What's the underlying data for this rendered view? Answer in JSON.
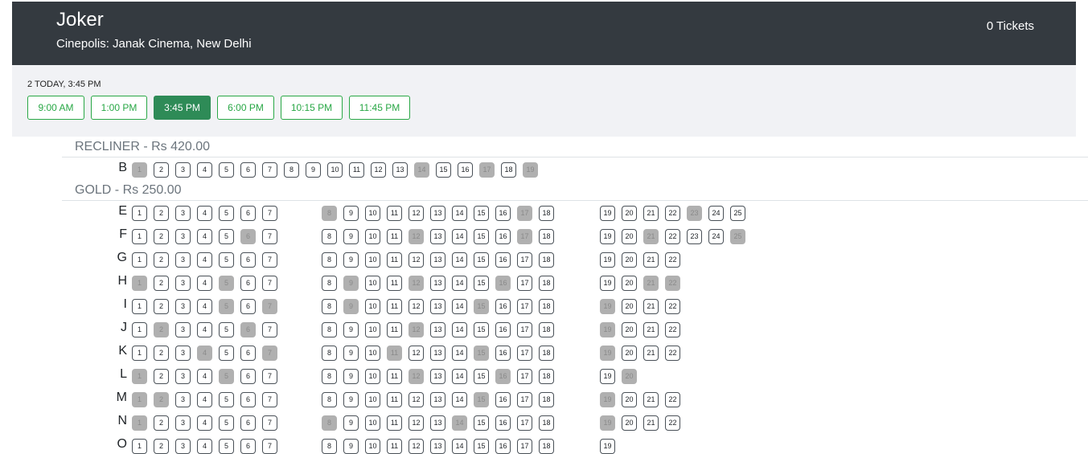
{
  "header": {
    "movie_title": "Joker",
    "venue": "Cinepolis: Janak Cinema, New Delhi",
    "tickets": "0 Tickets"
  },
  "showtimes": {
    "date_label": "2 TODAY, 3:45 PM",
    "times": [
      "9:00 AM",
      "1:00 PM",
      "3:45 PM",
      "6:00 PM",
      "10:15 PM",
      "11:45 PM"
    ],
    "selected": "3:45 PM"
  },
  "colors": {
    "header_bg": "#343a40",
    "accent": "#28a745",
    "selected": "#2e8b57",
    "sold_seat": "#b0b0b0"
  },
  "categories": [
    {
      "name": "RECLINER - Rs 420.00",
      "rows": [
        {
          "label": "B",
          "blocks": [
            [
              1,
              2,
              3,
              4,
              5,
              6,
              7,
              8,
              9,
              10,
              11,
              12,
              13,
              14,
              15,
              16,
              17,
              18,
              19
            ]
          ],
          "sold": [
            1,
            14,
            17,
            19
          ]
        }
      ]
    },
    {
      "name": "GOLD - Rs 250.00",
      "rows": [
        {
          "label": "E",
          "blocks": [
            [
              1,
              2,
              3,
              4,
              5,
              6,
              7
            ],
            [
              8,
              9,
              10,
              11,
              12,
              13,
              14,
              15,
              16,
              17,
              18
            ],
            [
              19,
              20,
              21,
              22,
              23,
              24,
              25
            ]
          ],
          "sold": [
            8,
            17,
            23
          ]
        },
        {
          "label": "F",
          "blocks": [
            [
              1,
              2,
              3,
              4,
              5,
              6,
              7
            ],
            [
              8,
              9,
              10,
              11,
              12,
              13,
              14,
              15,
              16,
              17,
              18
            ],
            [
              19,
              20,
              21,
              22,
              23,
              24,
              25
            ]
          ],
          "sold": [
            6,
            12,
            17,
            21,
            25
          ]
        },
        {
          "label": "G",
          "blocks": [
            [
              1,
              2,
              3,
              4,
              5,
              6,
              7
            ],
            [
              8,
              9,
              10,
              11,
              12,
              13,
              14,
              15,
              16,
              17,
              18
            ],
            [
              19,
              20,
              21,
              22
            ]
          ],
          "sold": []
        },
        {
          "label": "H",
          "blocks": [
            [
              1,
              2,
              3,
              4,
              5,
              6,
              7
            ],
            [
              8,
              9,
              10,
              11,
              12,
              13,
              14,
              15,
              16,
              17,
              18
            ],
            [
              19,
              20,
              21,
              22
            ]
          ],
          "sold": [
            1,
            5,
            9,
            12,
            16,
            21,
            22
          ]
        },
        {
          "label": "I",
          "blocks": [
            [
              1,
              2,
              3,
              4,
              5,
              6,
              7
            ],
            [
              8,
              9,
              10,
              11,
              12,
              13,
              14,
              15,
              16,
              17,
              18
            ],
            [
              19,
              20,
              21,
              22
            ]
          ],
          "sold": [
            5,
            7,
            9,
            15,
            19
          ]
        },
        {
          "label": "J",
          "blocks": [
            [
              1,
              2,
              3,
              4,
              5,
              6,
              7
            ],
            [
              8,
              9,
              10,
              11,
              12,
              13,
              14,
              15,
              16,
              17,
              18
            ],
            [
              19,
              20,
              21,
              22
            ]
          ],
          "sold": [
            2,
            6,
            12,
            19
          ]
        },
        {
          "label": "K",
          "blocks": [
            [
              1,
              2,
              3,
              4,
              5,
              6,
              7
            ],
            [
              8,
              9,
              10,
              11,
              12,
              13,
              14,
              15,
              16,
              17,
              18
            ],
            [
              19,
              20,
              21,
              22
            ]
          ],
          "sold": [
            4,
            7,
            11,
            15,
            19
          ]
        },
        {
          "label": "L",
          "blocks": [
            [
              1,
              2,
              3,
              4,
              5,
              6,
              7
            ],
            [
              8,
              9,
              10,
              11,
              12,
              13,
              14,
              15,
              16,
              17,
              18
            ],
            [
              19,
              20
            ]
          ],
          "sold": [
            1,
            5,
            12,
            16,
            20
          ]
        },
        {
          "label": "M",
          "blocks": [
            [
              1,
              2,
              3,
              4,
              5,
              6,
              7
            ],
            [
              8,
              9,
              10,
              11,
              12,
              13,
              14,
              15,
              16,
              17,
              18
            ],
            [
              19,
              20,
              21,
              22
            ]
          ],
          "sold": [
            1,
            2,
            15,
            19
          ]
        },
        {
          "label": "N",
          "blocks": [
            [
              1,
              2,
              3,
              4,
              5,
              6,
              7
            ],
            [
              8,
              9,
              10,
              11,
              12,
              13,
              14,
              15,
              16,
              17,
              18
            ],
            [
              19,
              20,
              21,
              22
            ]
          ],
          "sold": [
            1,
            8,
            14,
            19
          ]
        },
        {
          "label": "O",
          "blocks": [
            [
              1,
              2,
              3,
              4,
              5,
              6,
              7
            ],
            [
              8,
              9,
              10,
              11,
              12,
              13,
              14,
              15,
              16,
              17,
              18
            ],
            [
              19
            ]
          ],
          "sold": []
        }
      ]
    }
  ]
}
